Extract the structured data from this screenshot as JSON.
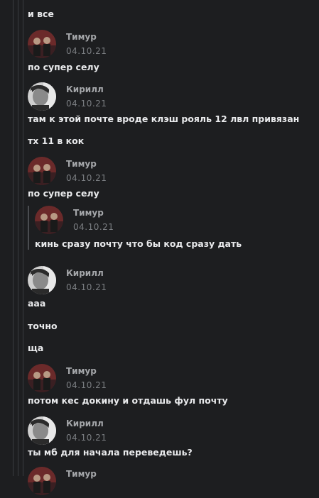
{
  "avatars": {
    "timur": {
      "name": "timur-avatar",
      "colors": [
        "#6b2a2a",
        "#3a1f22",
        "#b89a84",
        "#1a1a1a"
      ]
    },
    "kirill": {
      "name": "kirill-avatar",
      "colors": [
        "#cfcfcf",
        "#2b2b2b",
        "#8a8a8a",
        "#e8e8e8"
      ]
    }
  },
  "messages": [
    {
      "type": "text",
      "text": "и все"
    },
    {
      "type": "author",
      "author": "Тимур",
      "date": "04.10.21",
      "avatar": "timur"
    },
    {
      "type": "text",
      "text": "по супер селу"
    },
    {
      "type": "author",
      "author": "Кирилл",
      "date": "04.10.21",
      "avatar": "kirill"
    },
    {
      "type": "text",
      "text": "там к этой почте вроде клэш рояль 12 лвл привязан"
    },
    {
      "type": "text",
      "text": "тх 11 в кок"
    },
    {
      "type": "author",
      "author": "Тимур",
      "date": "04.10.21",
      "avatar": "timur"
    },
    {
      "type": "text",
      "text": "по супер селу"
    },
    {
      "type": "quote",
      "author": "Тимур",
      "date": "04.10.21",
      "avatar": "timur",
      "text": "кинь сразу почту что бы код сразу дать"
    },
    {
      "type": "author",
      "author": "Кирилл",
      "date": "04.10.21",
      "avatar": "kirill"
    },
    {
      "type": "text",
      "text": "ааа"
    },
    {
      "type": "text",
      "text": "точно"
    },
    {
      "type": "text",
      "text": "ща"
    },
    {
      "type": "author",
      "author": "Тимур",
      "date": "04.10.21",
      "avatar": "timur"
    },
    {
      "type": "text",
      "text": "потом кес докину и отдашь фул почту"
    },
    {
      "type": "author",
      "author": "Кирилл",
      "date": "04.10.21",
      "avatar": "kirill"
    },
    {
      "type": "text",
      "text": "ты мб для начала переведешь?"
    },
    {
      "type": "author",
      "author": "Тимур",
      "date": "",
      "avatar": "timur"
    }
  ]
}
